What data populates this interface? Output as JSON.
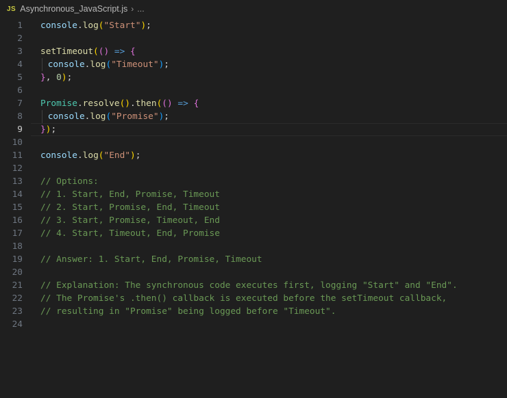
{
  "breadcrumb": {
    "icon_text": "JS",
    "file": "Asynchronous_JavaScript.js",
    "more": "..."
  },
  "editor": {
    "current_line": 9,
    "lines": [
      [
        [
          "console",
          "var"
        ],
        [
          ".",
          "pl"
        ],
        [
          "log",
          "fn"
        ],
        [
          "(",
          "p1"
        ],
        [
          "\"Start\"",
          "str"
        ],
        [
          ")",
          "p1"
        ],
        [
          ";",
          "pl"
        ]
      ],
      [],
      [
        [
          "setTimeout",
          "fn"
        ],
        [
          "(",
          "p1"
        ],
        [
          "()",
          "p2"
        ],
        [
          " ",
          "pl"
        ],
        [
          "=>",
          "kw"
        ],
        [
          " ",
          "pl"
        ],
        [
          "{",
          "p2"
        ]
      ],
      [
        [
          "|",
          ""
        ],
        [
          "console",
          "var"
        ],
        [
          ".",
          "pl"
        ],
        [
          "log",
          "fn"
        ],
        [
          "(",
          "p3"
        ],
        [
          "\"Timeout\"",
          "str"
        ],
        [
          ")",
          "p3"
        ],
        [
          ";",
          "pl"
        ]
      ],
      [
        [
          "}",
          "p2"
        ],
        [
          ", ",
          "pl"
        ],
        [
          "0",
          "num"
        ],
        [
          ")",
          "p1"
        ],
        [
          ";",
          "pl"
        ]
      ],
      [],
      [
        [
          "Promise",
          "cls"
        ],
        [
          ".",
          "pl"
        ],
        [
          "resolve",
          "fn"
        ],
        [
          "()",
          "p1"
        ],
        [
          ".",
          "pl"
        ],
        [
          "then",
          "fn"
        ],
        [
          "(",
          "p1"
        ],
        [
          "()",
          "p2"
        ],
        [
          " ",
          "pl"
        ],
        [
          "=>",
          "kw"
        ],
        [
          " ",
          "pl"
        ],
        [
          "{",
          "p2"
        ]
      ],
      [
        [
          "|",
          ""
        ],
        [
          "console",
          "var"
        ],
        [
          ".",
          "pl"
        ],
        [
          "log",
          "fn"
        ],
        [
          "(",
          "p3"
        ],
        [
          "\"Promise\"",
          "str"
        ],
        [
          ")",
          "p3"
        ],
        [
          ";",
          "pl"
        ]
      ],
      [
        [
          "}",
          "p2"
        ],
        [
          ")",
          "p1"
        ],
        [
          ";",
          "pl"
        ]
      ],
      [],
      [
        [
          "console",
          "var"
        ],
        [
          ".",
          "pl"
        ],
        [
          "log",
          "fn"
        ],
        [
          "(",
          "p1"
        ],
        [
          "\"End\"",
          "str"
        ],
        [
          ")",
          "p1"
        ],
        [
          ";",
          "pl"
        ]
      ],
      [],
      [
        [
          "// Options:",
          "com"
        ]
      ],
      [
        [
          "// 1. Start, End, Promise, Timeout",
          "com"
        ]
      ],
      [
        [
          "// 2. Start, Promise, End, Timeout",
          "com"
        ]
      ],
      [
        [
          "// 3. Start, Promise, Timeout, End",
          "com"
        ]
      ],
      [
        [
          "// 4. Start, Timeout, End, Promise",
          "com"
        ]
      ],
      [],
      [
        [
          "// Answer: 1. Start, End, Promise, Timeout",
          "com"
        ]
      ],
      [],
      [
        [
          "// Explanation: The synchronous code executes first, logging \"Start\" and \"End\".",
          "com"
        ]
      ],
      [
        [
          "// The Promise's .then() callback is executed before the setTimeout callback,",
          "com"
        ]
      ],
      [
        [
          "// resulting in \"Promise\" being logged before \"Timeout\".",
          "com"
        ]
      ],
      []
    ]
  },
  "colors": {
    "background": "#1f1f1f",
    "comment": "#6a9955",
    "string": "#ce9178",
    "function": "#dcdcaa",
    "variable": "#9cdcfe",
    "keyword": "#569cd6",
    "class": "#4ec9b0"
  }
}
